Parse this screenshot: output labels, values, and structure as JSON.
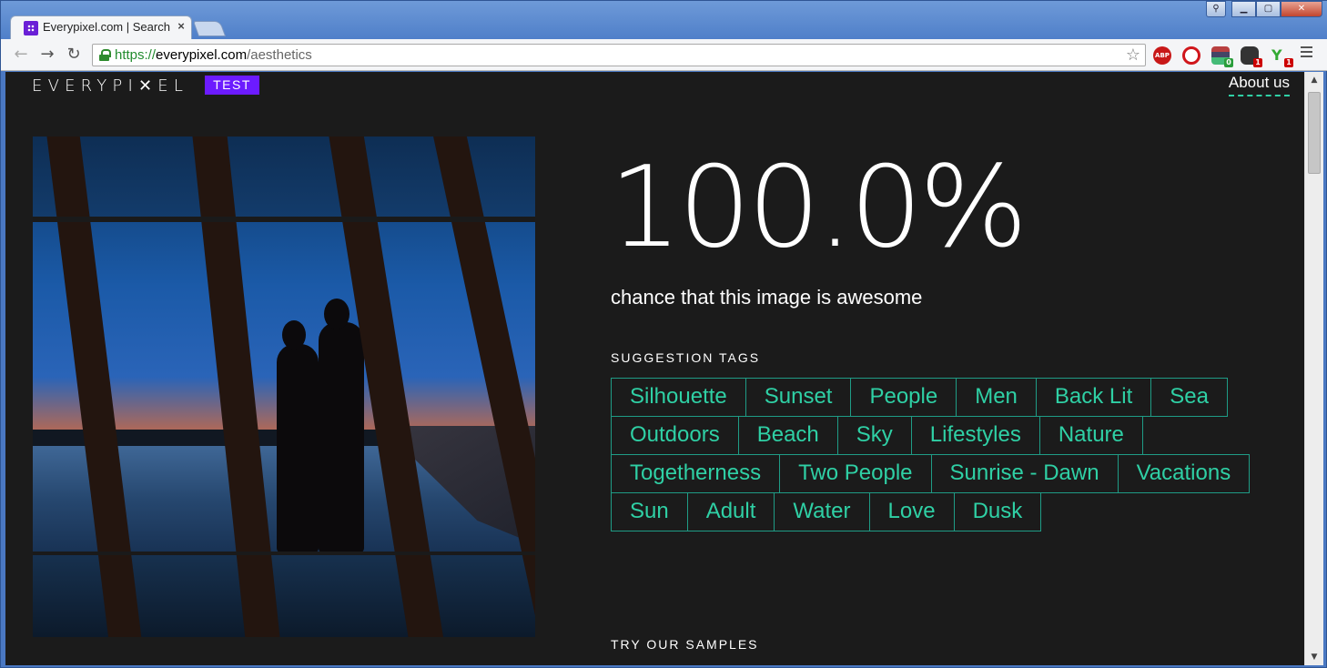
{
  "browser": {
    "tab_title": "Everypixel.com | Search",
    "tab_close": "×",
    "url_scheme": "https://",
    "url_host": "everypixel.com",
    "url_path": "/aesthetics",
    "ext_abp_label": "ABP",
    "ext_list_badge": "0",
    "ext_ghost_badge": "1",
    "ext_sprout_badge": "1"
  },
  "header": {
    "logo": "EVERYPI✕EL",
    "test_badge": "TEST",
    "about": "About us"
  },
  "result": {
    "score": "100.0%",
    "caption": "chance that this image is awesome"
  },
  "tags_section": {
    "label": "SUGGESTION TAGS",
    "rows": [
      [
        "Silhouette",
        "Sunset",
        "People",
        "Men",
        "Back Lit",
        "Sea"
      ],
      [
        "Outdoors",
        "Beach",
        "Sky",
        "Lifestyles",
        "Nature"
      ],
      [
        "Togetherness",
        "Two People",
        "Sunrise - Dawn",
        "Vacations"
      ],
      [
        "Sun",
        "Adult",
        "Water",
        "Love",
        "Dusk"
      ]
    ]
  },
  "samples_section": {
    "label": "TRY OUR SAMPLES"
  },
  "colors": {
    "accent": "#2fd0a5",
    "badge": "#6c1bff",
    "background": "#1b1b1b"
  }
}
